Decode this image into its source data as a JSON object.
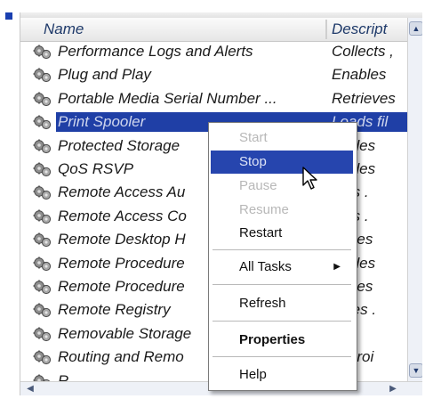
{
  "header": {
    "name_col": "Name",
    "desc_col": "Descript"
  },
  "services": [
    {
      "name": "Performance Logs and Alerts",
      "desc": "Collects ,"
    },
    {
      "name": "Plug and Play",
      "desc": "Enables"
    },
    {
      "name": "Portable Media Serial Number ...",
      "desc": "Retrieves"
    },
    {
      "name": "Print Spooler",
      "desc": "Loads fil"
    },
    {
      "name": "Protected Storage",
      "desc": "ovides"
    },
    {
      "name": "QoS RSVP",
      "desc": "ovides"
    },
    {
      "name": "Remote Access Au",
      "desc": "ates ."
    },
    {
      "name": "Remote Access Co",
      "desc": "ates ."
    },
    {
      "name": "Remote Desktop H",
      "desc": "nages"
    },
    {
      "name": "Remote Procedure",
      "desc": "ovides"
    },
    {
      "name": "Remote Procedure",
      "desc": "nages"
    },
    {
      "name": "Remote Registry",
      "desc": "ables ."
    },
    {
      "name": "Removable Storage",
      "desc": ""
    },
    {
      "name": "Routing and Remo",
      "desc": "ers roi"
    },
    {
      "name": "R.....",
      "desc": ""
    }
  ],
  "selected_index": 3,
  "context_menu": {
    "start": "Start",
    "stop": "Stop",
    "pause": "Pause",
    "resume": "Resume",
    "restart": "Restart",
    "all_tasks": "All Tasks",
    "refresh": "Refresh",
    "properties": "Properties",
    "help": "Help"
  },
  "icons": {
    "service": "gears-icon",
    "submenu": "triangle-right-icon"
  },
  "colors": {
    "selection": "#1f3fa6",
    "menu_highlight": "#2645ae",
    "header_text": "#1f3a6a"
  }
}
